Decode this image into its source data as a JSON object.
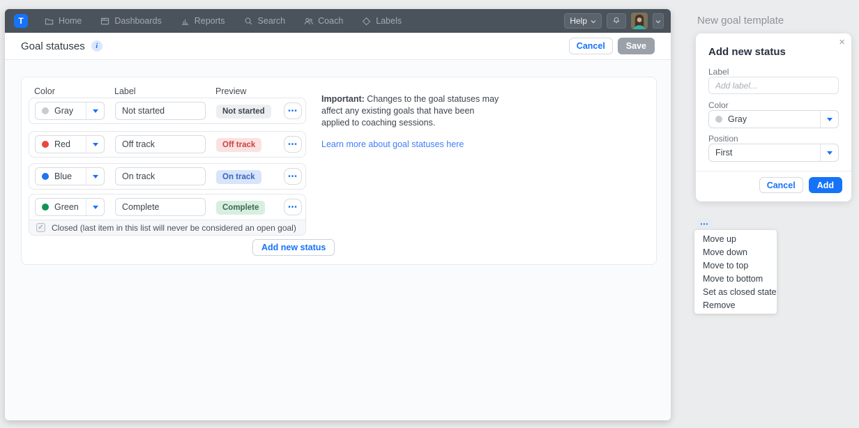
{
  "app": {
    "nav": {
      "logo_text": "T",
      "items": [
        {
          "label": "Home",
          "icon": "folder-icon"
        },
        {
          "label": "Dashboards",
          "icon": "dashboards-icon"
        },
        {
          "label": "Reports",
          "icon": "bar-chart-icon"
        },
        {
          "label": "Search",
          "icon": "search-icon"
        },
        {
          "label": "Coach",
          "icon": "people-icon"
        },
        {
          "label": "Labels",
          "icon": "tag-icon"
        }
      ],
      "help_label": "Help"
    },
    "header": {
      "title": "Goal statuses",
      "cancel_label": "Cancel",
      "save_label": "Save"
    },
    "statuses": {
      "columns": [
        "Color",
        "Label",
        "Preview"
      ],
      "rows": [
        {
          "color_name": "Gray",
          "dot_color": "#c7ccd1",
          "label_value": "Not started",
          "badge_text": "Not started",
          "badge_bg": "#eceef0",
          "badge_fg": "#3e4550"
        },
        {
          "color_name": "Red",
          "dot_color": "#e8473f",
          "label_value": "Off track",
          "badge_text": "Off track",
          "badge_bg": "#fbe2e2",
          "badge_fg": "#cc423c"
        },
        {
          "color_name": "Blue",
          "dot_color": "#2173f0",
          "label_value": "On track",
          "badge_text": "On track",
          "badge_bg": "#d8e4f9",
          "badge_fg": "#3566c4"
        },
        {
          "color_name": "Green",
          "dot_color": "#0f9454",
          "label_value": "Complete",
          "badge_text": "Complete",
          "badge_bg": "#d7efe0",
          "badge_fg": "#40684f"
        }
      ],
      "closed_note": "Closed (last item in this list will never be considered an open goal)",
      "closed_checkmark": "✓",
      "add_button_label": "Add new status"
    },
    "notice": {
      "lead": "Important:",
      "body": " Changes to the goal statuses may affect any existing goals that have been applied to coaching sessions.",
      "link_label": "Learn more about goal statuses here"
    }
  },
  "side": {
    "title": "New goal template",
    "modal": {
      "title": "Add new status",
      "close_glyph": "×",
      "label_field": {
        "label": "Label",
        "placeholder": "Add label..."
      },
      "color_field": {
        "label": "Color",
        "value": "Gray",
        "dot_color": "#c7ccd1"
      },
      "position_field": {
        "label": "Position",
        "value": "First"
      },
      "cancel_label": "Cancel",
      "add_label": "Add"
    },
    "menu": {
      "items": [
        "Move up",
        "Move down",
        "Move to top",
        "Move to bottom",
        "Set as closed state",
        "Remove"
      ]
    }
  },
  "ui": {
    "ellipsis": "•••"
  },
  "colors": {
    "accent": "#1673f8",
    "link": "#3e7efc",
    "nav_bg": "#4a525b",
    "save_disabled_bg": "#9ba1a9"
  }
}
